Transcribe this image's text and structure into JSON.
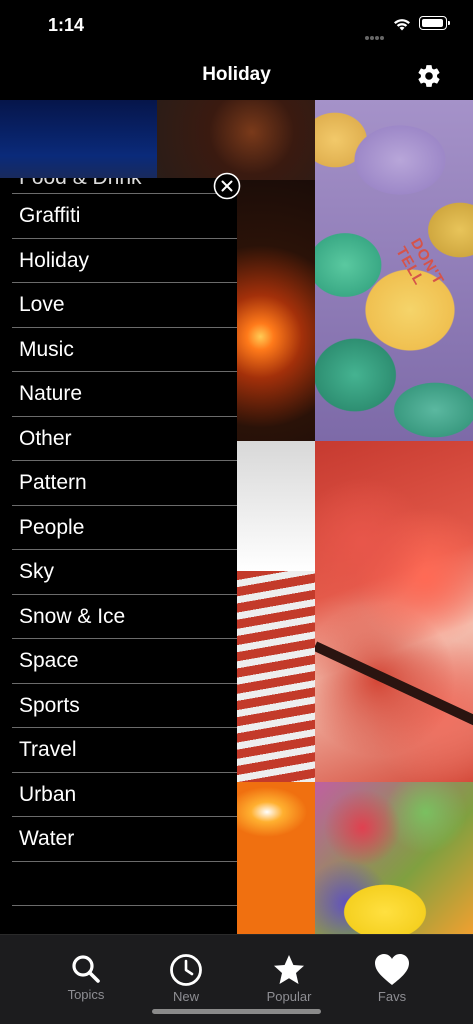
{
  "status_bar": {
    "time": "1:14"
  },
  "nav": {
    "title": "Holiday"
  },
  "menu": {
    "partial_item": "Food & Drink",
    "items": [
      "Graffiti",
      "Holiday",
      "Love",
      "Music",
      "Nature",
      "Other",
      "Pattern",
      "People",
      "Sky",
      "Snow & Ice",
      "Space",
      "Sports",
      "Travel",
      "Urban",
      "Water"
    ]
  },
  "photos": {
    "candy_heart_text": "DON'T TELL"
  },
  "tab_bar": {
    "tabs": [
      {
        "label": "Topics",
        "icon": "search-icon"
      },
      {
        "label": "New",
        "icon": "clock-icon"
      },
      {
        "label": "Popular",
        "icon": "star-icon"
      },
      {
        "label": "Favs",
        "icon": "heart-icon"
      }
    ]
  },
  "colors": {
    "background": "#000000",
    "tab_bar_background": "#1c1c1e",
    "tab_label": "#8e8e93",
    "divider": "#6b6b6b"
  }
}
